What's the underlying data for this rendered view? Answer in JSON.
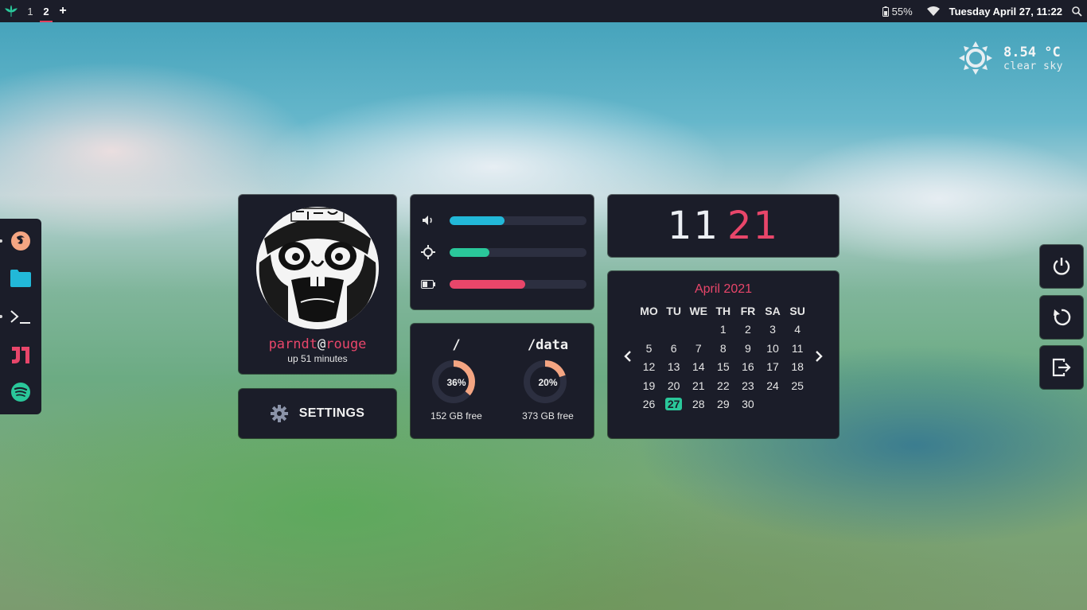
{
  "topbar": {
    "workspaces": [
      "1",
      "2"
    ],
    "active_workspace": "2",
    "add_label": "+",
    "battery": "55%",
    "datetime": "Tuesday April 27, 11:22"
  },
  "weather": {
    "temperature": "8.54 °C",
    "condition": "clear sky"
  },
  "dock": {
    "apps": [
      "firefox-icon",
      "folder-icon",
      "terminal-icon",
      "jetbrains-icon",
      "spotify-icon"
    ]
  },
  "profile": {
    "username": "parndt",
    "at": "@",
    "host": "rouge",
    "uptime": "up 51 minutes"
  },
  "settings": {
    "label": "SETTINGS"
  },
  "sliders": {
    "volume": 0.4,
    "brightness": 0.29,
    "battery": 0.55,
    "colors": {
      "volume": "#22b8d8",
      "brightness": "#2ac79a",
      "battery": "#e8466a"
    }
  },
  "disks": [
    {
      "mount": "/",
      "used_pct": 36,
      "pct_label": "36%",
      "free": "152 GB free"
    },
    {
      "mount": "/data",
      "used_pct": 20,
      "pct_label": "20%",
      "free": "373 GB free"
    }
  ],
  "clock": {
    "hours": "11",
    "minutes": "21"
  },
  "calendar": {
    "month": "April 2021",
    "weekdays": [
      "MO",
      "TU",
      "WE",
      "TH",
      "FR",
      "SA",
      "SU"
    ],
    "weeks": [
      [
        "",
        "",
        "",
        "1",
        "2",
        "3",
        "4"
      ],
      [
        "5",
        "6",
        "7",
        "8",
        "9",
        "10",
        "11"
      ],
      [
        "12",
        "13",
        "14",
        "15",
        "16",
        "17",
        "18"
      ],
      [
        "19",
        "20",
        "21",
        "22",
        "23",
        "24",
        "25"
      ],
      [
        "26",
        "27",
        "28",
        "29",
        "30",
        "",
        ""
      ]
    ],
    "today": "27"
  },
  "power_menu": [
    "power-icon",
    "restart-icon",
    "logout-icon"
  ],
  "colors": {
    "accent": "#e8466a",
    "panel": "#1b1d29",
    "disk": "#f4a582",
    "today": "#2ac79a"
  }
}
